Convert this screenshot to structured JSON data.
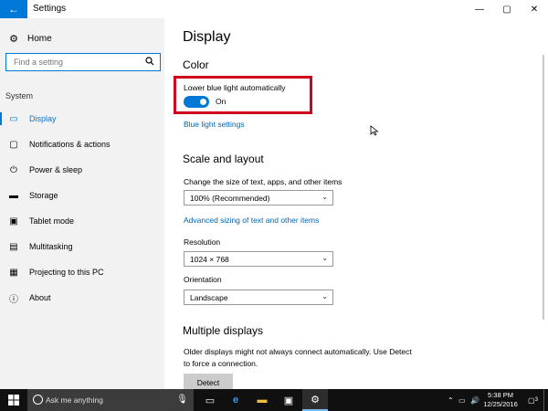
{
  "window": {
    "title": "Settings",
    "back_icon": "back-arrow-icon",
    "minimize_glyph": "—",
    "maximize_glyph": "▢",
    "close_glyph": "✕"
  },
  "sidebar": {
    "home_label": "Home",
    "search_placeholder": "Find a setting",
    "section_label": "System",
    "items": [
      {
        "label": "Display",
        "icon": "monitor-icon",
        "glyph": "▭",
        "active": true
      },
      {
        "label": "Notifications & actions",
        "icon": "notifications-icon",
        "glyph": "▢"
      },
      {
        "label": "Power & sleep",
        "icon": "power-icon",
        "glyph": "⏻"
      },
      {
        "label": "Storage",
        "icon": "storage-icon",
        "glyph": "▬"
      },
      {
        "label": "Tablet mode",
        "icon": "tablet-icon",
        "glyph": "▣"
      },
      {
        "label": "Multitasking",
        "icon": "multitasking-icon",
        "glyph": "▤"
      },
      {
        "label": "Projecting to this PC",
        "icon": "projecting-icon",
        "glyph": "▦"
      },
      {
        "label": "About",
        "icon": "about-icon",
        "glyph": "ⓘ"
      }
    ]
  },
  "main": {
    "page_title": "Display",
    "color_heading": "Color",
    "night_light_label": "Lower blue light automatically",
    "night_light_state": "On",
    "night_light_on": true,
    "blue_light_link": "Blue light settings",
    "scale_heading": "Scale and layout",
    "scale_label": "Change the size of text, apps, and other items",
    "scale_value": "100% (Recommended)",
    "advanced_link": "Advanced sizing of text and other items",
    "resolution_label": "Resolution",
    "resolution_value": "1024 × 768",
    "orientation_label": "Orientation",
    "orientation_value": "Landscape",
    "multiple_heading": "Multiple displays",
    "multiple_text_1": "Older displays might not always connect automatically. Use Detect",
    "multiple_text_2": "to force a connection.",
    "detect_button": "Detect"
  },
  "taskbar": {
    "search_text": "Ask me anything",
    "time": "5:38 PM",
    "date": "12/25/2016",
    "notification_count": "3"
  },
  "colors": {
    "accent": "#0078d7",
    "highlight_border": "#d0021b",
    "link": "#0063b1"
  }
}
